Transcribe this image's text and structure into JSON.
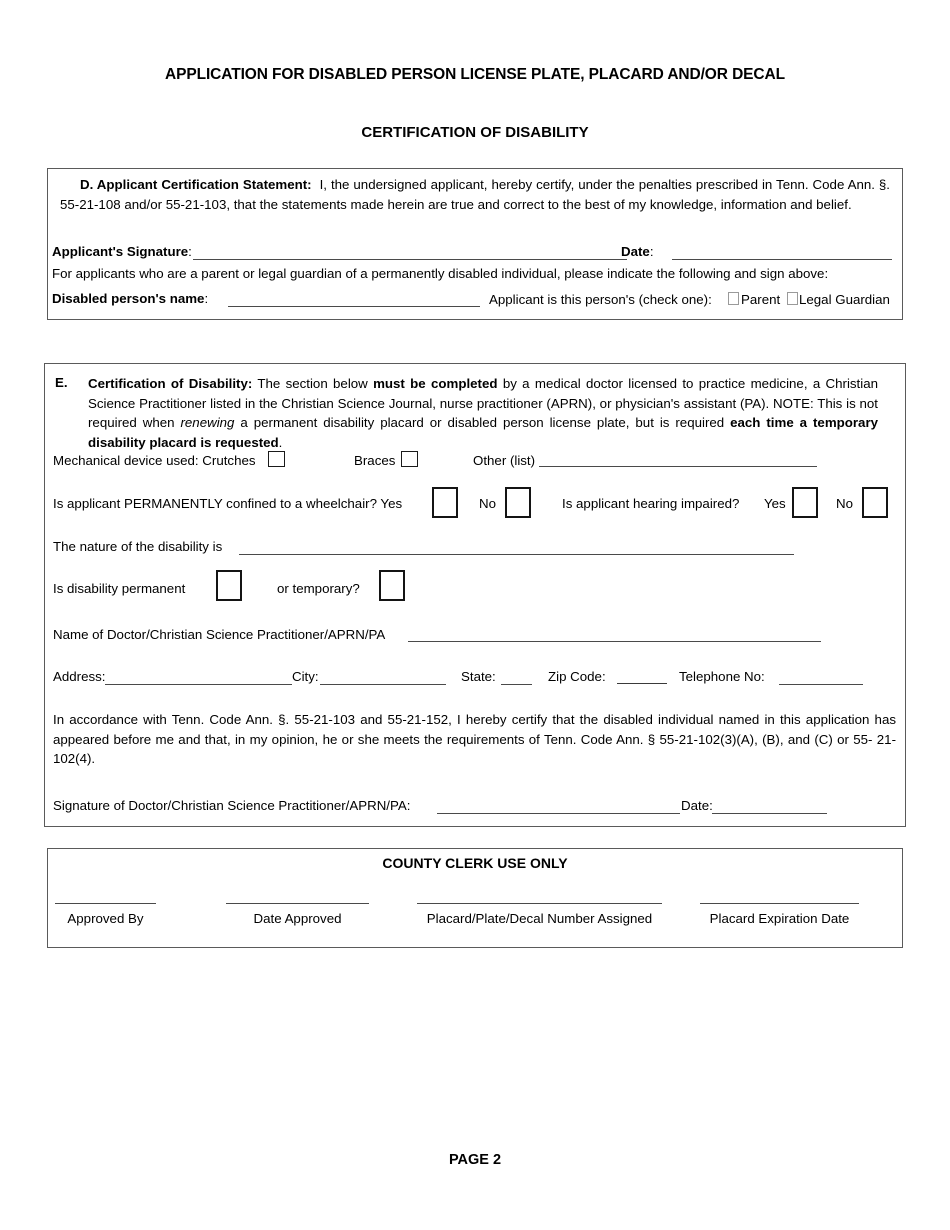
{
  "document": {
    "title": "APPLICATION FOR DISABLED PERSON LICENSE PLATE, PLACARD AND/OR DECAL",
    "subtitle": "CERTIFICATION OF DISABILITY",
    "footer": "PAGE 2"
  },
  "section_d": {
    "heading": "D. Applicant Certification Statement:",
    "body": "I, the undersigned applicant, hereby certify, under the penalties prescribed in Tenn. Code Ann. §. 55-21-108 and/or 55-21-103, that the statements made herein are true and correct to the best of my knowledge, information and belief.",
    "signature_label": "Applicant's Signature",
    "signature_colon": ":",
    "date_label": "Date",
    "date_colon": ":",
    "guardian_note": "For applicants who are a parent or legal guardian of a permanently disabled individual, please indicate the following and sign above:",
    "disabled_person_label": "Disabled person's name",
    "disabled_person_colon": ":",
    "check_one_label": "Applicant is this person's (check one):",
    "parent_label": "Parent",
    "legal_guardian_label": "Legal Guardian"
  },
  "section_e": {
    "letter": "E.",
    "heading": "Certification of Disability:",
    "body_1": "The section below",
    "body_bold_1": "must be completed",
    "body_2": "by a medical doctor licensed to practice medicine, a Christian Science Practitioner listed in the Christian Science Journal, nurse practitioner (APRN), or physician's assistant (PA). NOTE: This is not required when",
    "body_italic": "renewing",
    "body_3": "a permanent disability placard or disabled person license plate",
    "body_4": ", but is required",
    "body_bold_2": "each time a temporary disability placard is requested",
    "body_5": ".",
    "mechanical_device_label": "Mechanical device used: Crutches",
    "braces_label": "Braces",
    "other_label": "Other (list)",
    "wheelchair_question": "Is applicant PERMANENTLY confined to a wheelchair? Yes",
    "wheelchair_no": "No",
    "hearing_question": "Is applicant hearing impaired?",
    "hearing_yes": "Yes",
    "hearing_no": "No",
    "nature_label": "The nature of the disability is",
    "permanent_label": "Is disability permanent",
    "temporary_label": "or temporary?",
    "doctor_name_label": "Name of Doctor/Christian Science Practitioner/APRN/PA",
    "address_label": "Address:",
    "city_label": "City:",
    "state_label": "State:",
    "zip_label": "Zip Code:",
    "telephone_label": "Telephone No:",
    "accordance_text": "In accordance with Tenn. Code Ann. §. 55-21-103 and 55-21-152, I hereby certify that the disabled individual named in this application has appeared before me and that, in my opinion, he or she meets the requirements of Tenn. Code Ann. § 55-21-102(3)(A), (B), and (C) or 55- 21-102(4).",
    "doctor_signature_label": "Signature of Doctor/Christian Science Practitioner/APRN/PA:",
    "doctor_date_label": "Date:"
  },
  "county_clerk": {
    "title": "COUNTY CLERK USE ONLY",
    "fields": [
      {
        "label": "Approved By"
      },
      {
        "label": "Date Approved"
      },
      {
        "label": "Placard/Plate/Decal Number Assigned"
      },
      {
        "label": "Placard Expiration Date"
      }
    ]
  }
}
